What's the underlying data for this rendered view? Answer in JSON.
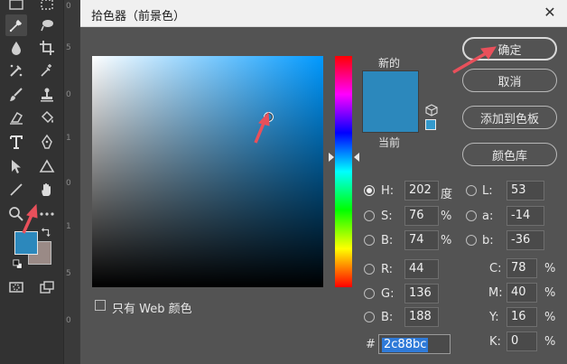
{
  "dialog": {
    "title": "拾色器（前景色）",
    "close_symbol": "✕",
    "new_label": "新的",
    "current_label": "当前",
    "only_web_colors_label": "只有 Web 颜色",
    "buttons": {
      "ok": "确定",
      "cancel": "取消",
      "add_to_swatches": "添加到色板",
      "color_libraries": "颜色库"
    },
    "hsb": {
      "h": {
        "label": "H:",
        "value": "202",
        "unit": "度"
      },
      "s": {
        "label": "S:",
        "value": "76",
        "unit": "%"
      },
      "b": {
        "label": "B:",
        "value": "74",
        "unit": "%"
      }
    },
    "lab": {
      "l": {
        "label": "L:",
        "value": "53"
      },
      "a": {
        "label": "a:",
        "value": "-14"
      },
      "b": {
        "label": "b:",
        "value": "-36"
      }
    },
    "rgb": {
      "r": {
        "label": "R:",
        "value": "44"
      },
      "g": {
        "label": "G:",
        "value": "136"
      },
      "b": {
        "label": "B:",
        "value": "188"
      }
    },
    "cmyk": {
      "c": {
        "label": "C:",
        "value": "78",
        "unit": "%"
      },
      "m": {
        "label": "M:",
        "value": "40",
        "unit": "%"
      },
      "y": {
        "label": "Y:",
        "value": "16",
        "unit": "%"
      },
      "k": {
        "label": "K:",
        "value": "0",
        "unit": "%"
      }
    },
    "hex": {
      "label": "#",
      "value": "2c88bc"
    },
    "selected_mode": "H"
  },
  "colors": {
    "foreground": "#2c88bc",
    "background": "#9a8a86",
    "accent_arrow": "#e8505b",
    "hex_selection": "#2f7ad8"
  },
  "ruler": {
    "marks": [
      "0",
      "5",
      "0",
      "1",
      "0",
      "1",
      "5",
      "0"
    ]
  },
  "toolbar": {
    "tools": [
      "marquee-icon",
      "eyedropper-icon",
      "lasso-icon",
      "crop-icon",
      "blur-icon",
      "color-sampler-icon",
      "brush-icon",
      "stamp-icon",
      "eraser-icon",
      "paint-bucket-icon",
      "type-icon",
      "pen-icon",
      "selection-arrow-icon",
      "triangle-shape-icon",
      "line-icon",
      "hand-icon",
      "zoom-icon",
      "more-icon",
      "swap-colors-icon",
      "default-colors-icon",
      "quick-mask-icon",
      "screen-mode-icon"
    ]
  }
}
